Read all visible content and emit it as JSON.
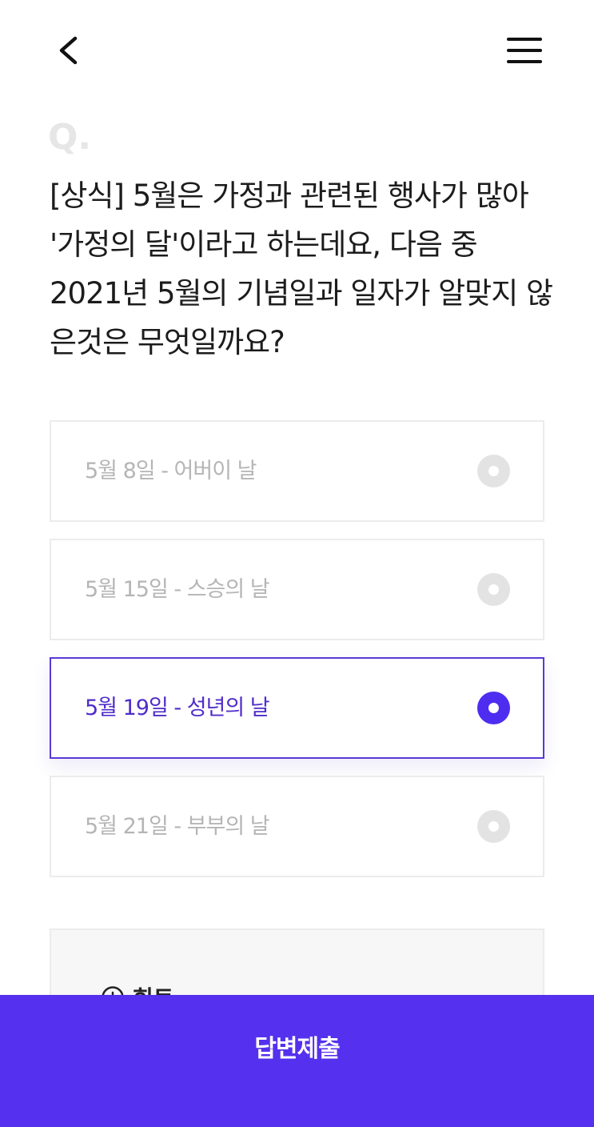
{
  "header": {
    "back_icon": "chevron-left-icon",
    "menu_icon": "hamburger-menu-icon"
  },
  "question": {
    "marker": "Q.",
    "text": "[상식] 5월은 가정과 관련된 행사가 많아 '가정의 달'이라고 하는데요, 다음 중 2021년 5월의 기념일과 일자가 알맞지 않은것은 무엇일까요?"
  },
  "options": [
    {
      "label": "5월 8일 - 어버이 날",
      "selected": false
    },
    {
      "label": "5월 15일 - 스승의 날",
      "selected": false
    },
    {
      "label": "5월 19일 - 성년의 날",
      "selected": true
    },
    {
      "label": "5월 21일 - 부부의 날",
      "selected": false
    }
  ],
  "hint": {
    "icon": "plus-circle-icon",
    "title": "힌트"
  },
  "submit": {
    "label": "답변제출"
  },
  "colors": {
    "accent": "#5530ee",
    "selected_text": "#4f2dc9",
    "unselected_text": "#b5b5b5",
    "radio_off": "#e3e3e3",
    "border": "#ececec"
  }
}
